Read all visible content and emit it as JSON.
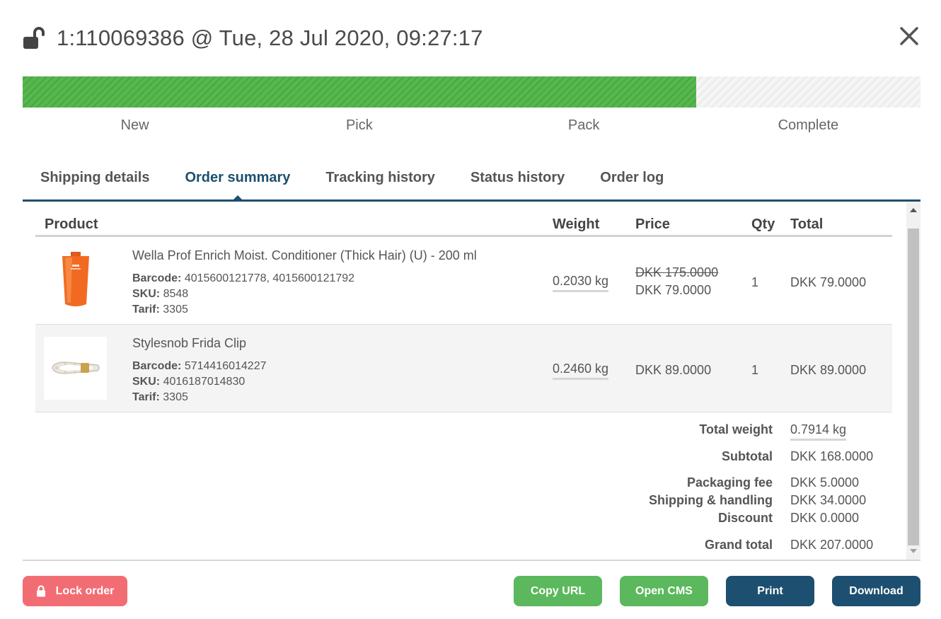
{
  "header": {
    "title": "1:110069386 @ Tue, 28 Jul 2020, 09:27:17",
    "icon": "unlocked-padlock-icon",
    "close_icon": "close-icon"
  },
  "progress": {
    "percent": 75,
    "color": "#55b84d"
  },
  "steps": [
    "New",
    "Pick",
    "Pack",
    "Complete"
  ],
  "tabs": [
    {
      "label": "Shipping details",
      "active": false
    },
    {
      "label": "Order summary",
      "active": true
    },
    {
      "label": "Tracking history",
      "active": false
    },
    {
      "label": "Status history",
      "active": false
    },
    {
      "label": "Order log",
      "active": false
    }
  ],
  "table": {
    "headers": {
      "product": "Product",
      "weight": "Weight",
      "price": "Price",
      "qty": "Qty",
      "total": "Total"
    },
    "rows": [
      {
        "name": "Wella Prof Enrich Moist. Conditioner (Thick Hair) (U) - 200 ml",
        "barcode_label": "Barcode:",
        "barcode": "4015600121778, 4015600121792",
        "sku_label": "SKU:",
        "sku": "8548",
        "tarif_label": "Tarif:",
        "tarif": "3305",
        "weight": "0.2030 kg",
        "price_old": "DKK 175.0000",
        "price": "DKK 79.0000",
        "qty": "1",
        "total": "DKK 79.0000"
      },
      {
        "name": "Stylesnob Frida Clip",
        "barcode_label": "Barcode:",
        "barcode": "5714416014227",
        "sku_label": "SKU:",
        "sku": "4016187014830",
        "tarif_label": "Tarif:",
        "tarif": "3305",
        "weight": "0.2460 kg",
        "price": "DKK 89.0000",
        "qty": "1",
        "total": "DKK 89.0000"
      }
    ]
  },
  "totals": {
    "total_weight_label": "Total weight",
    "total_weight": "0.7914 kg",
    "subtotal_label": "Subtotal",
    "subtotal": "DKK 168.0000",
    "packaging_label": "Packaging fee",
    "packaging": "DKK 5.0000",
    "shipping_label": "Shipping & handling",
    "shipping": "DKK 34.0000",
    "discount_label": "Discount",
    "discount": "DKK 0.0000",
    "grand_total_label": "Grand total",
    "grand_total": "DKK 207.0000"
  },
  "buttons": {
    "lock": "Lock order",
    "copy_url": "Copy URL",
    "open_cms": "Open CMS",
    "print": "Print",
    "download": "Download"
  },
  "colors": {
    "accent": "#1d4f70",
    "success": "#5cb85c",
    "danger": "#f26d73"
  }
}
